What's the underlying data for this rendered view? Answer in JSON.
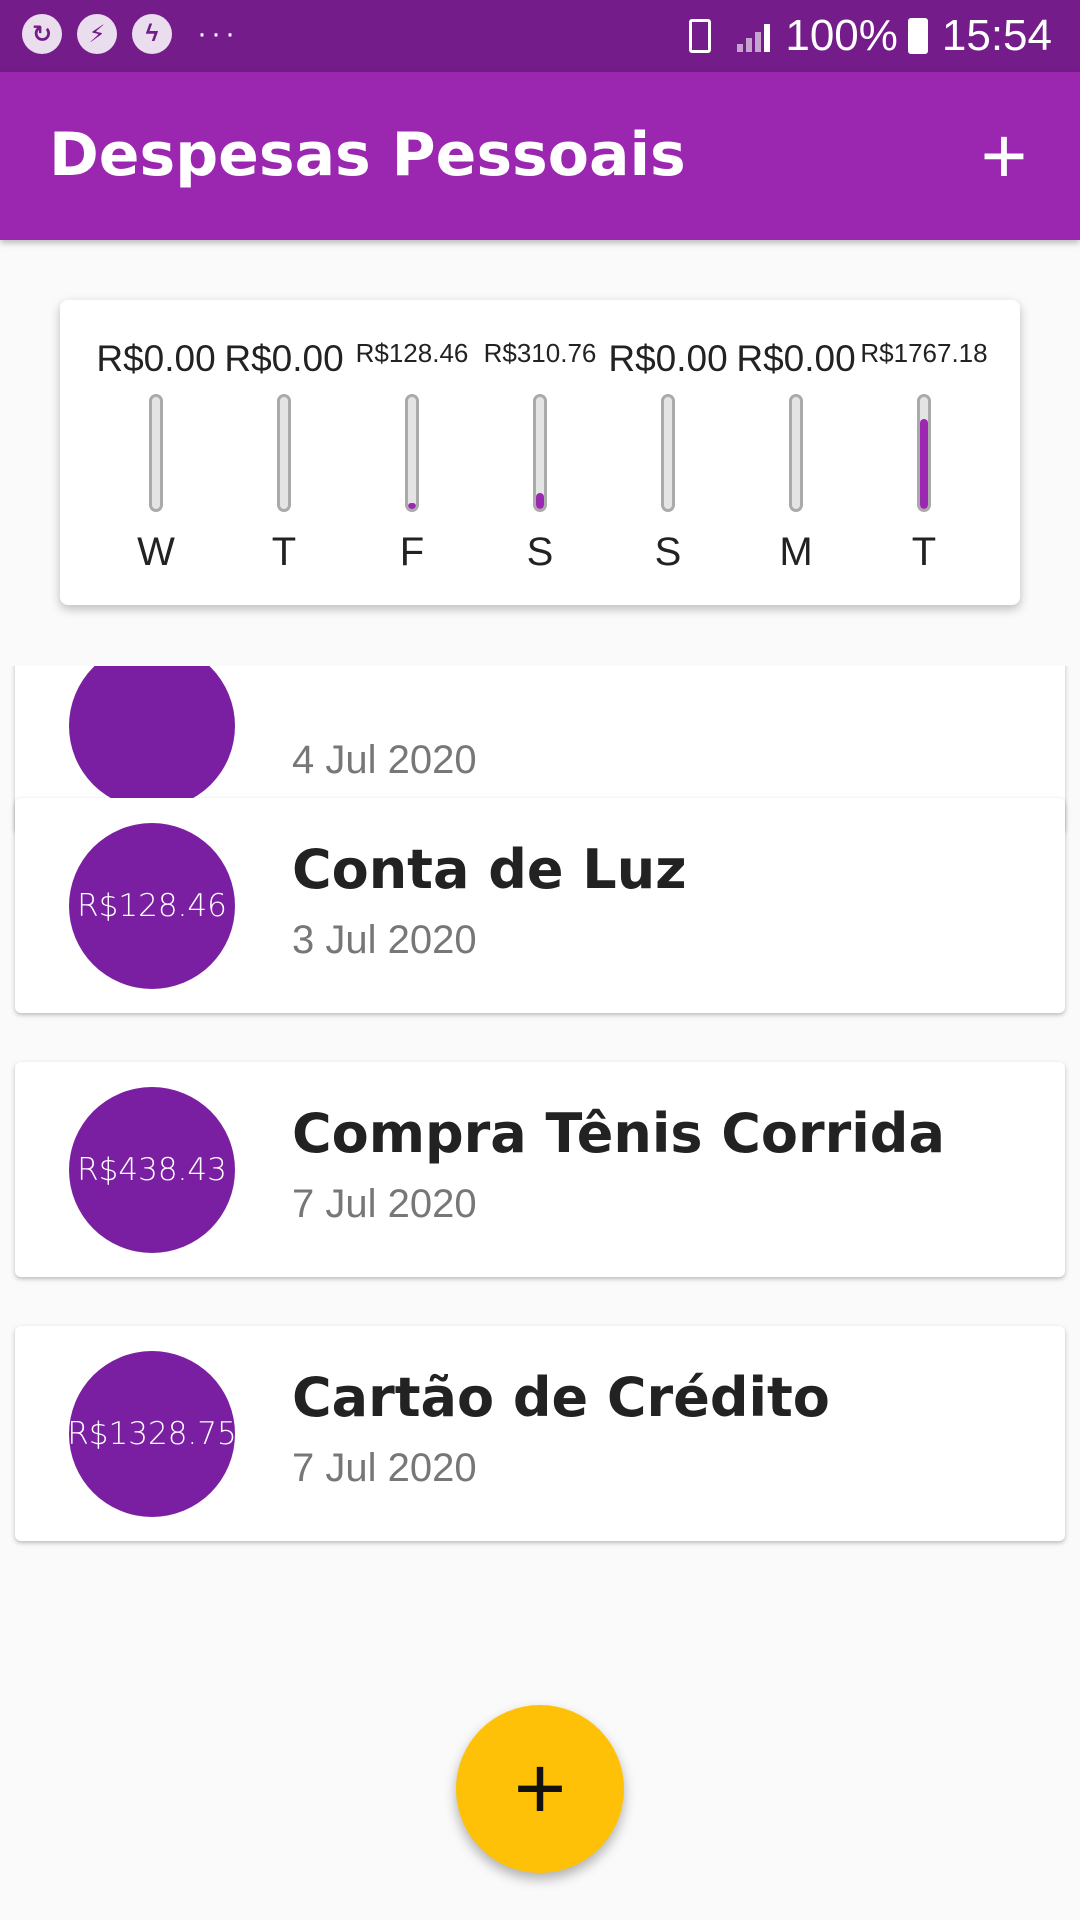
{
  "status_bar": {
    "icons": [
      "sync-icon",
      "run-icon",
      "messenger-icon"
    ],
    "more": "···",
    "battery_percent": "100%",
    "time": "15:54"
  },
  "app_bar": {
    "title": "Despesas Pessoais",
    "add_label": "+"
  },
  "chart_data": {
    "type": "bar",
    "categories": [
      "W",
      "T",
      "F",
      "S",
      "S",
      "M",
      "T"
    ],
    "value_labels": [
      "R$0.00",
      "R$0.00",
      "R$128.46",
      "R$310.76",
      "R$0.00",
      "R$0.00",
      "R$1767.18"
    ],
    "values": [
      0,
      0,
      128.46,
      310.76,
      0,
      0,
      1767.18
    ],
    "fill_fraction": [
      0,
      0,
      0.058,
      0.141,
      0,
      0,
      0.802
    ],
    "bar_color": "#9c27b0"
  },
  "transactions": [
    {
      "amount": "",
      "title": "",
      "date": "4 Jul 2020"
    },
    {
      "amount": "R$128.46",
      "title": "Conta de Luz",
      "date": "3 Jul 2020"
    },
    {
      "amount": "R$438.43",
      "title": "Compra Tênis Corrida",
      "date": "7 Jul 2020"
    },
    {
      "amount": "R$1328.75",
      "title": "Cartão de Crédito",
      "date": "7 Jul 2020"
    }
  ],
  "fab": {
    "label": "+"
  },
  "colors": {
    "primary": "#9b27b1",
    "primary_dark": "#741c8a",
    "avatar": "#7a1fa2",
    "accent": "#ffc107"
  }
}
